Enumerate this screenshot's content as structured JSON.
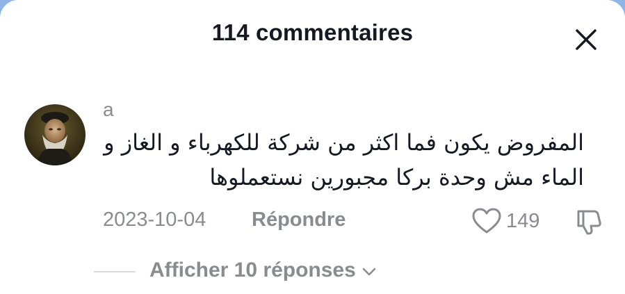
{
  "header": {
    "title": "114 commentaires",
    "close_icon": "close-icon"
  },
  "comment": {
    "avatar_icon": "avatar",
    "username": "a",
    "text_line1": "المفروض يكون فما اكثر من شركة للكهرباء و الغاز و",
    "text_line2": "الماء مش وحدة بركا مجبورين نستعملوها",
    "date": "2023-10-04",
    "reply_label": "Répondre",
    "like_icon": "heart-icon",
    "like_count": "149",
    "dislike_icon": "thumbs-down-icon"
  },
  "replies": {
    "label": "Afficher 10 réponses",
    "icon": "chevron-down-icon"
  },
  "colors": {
    "text_primary": "#161823",
    "text_secondary": "#8a8b91",
    "divider": "#d9d9dc",
    "background_edge": "#8fb4e8"
  }
}
